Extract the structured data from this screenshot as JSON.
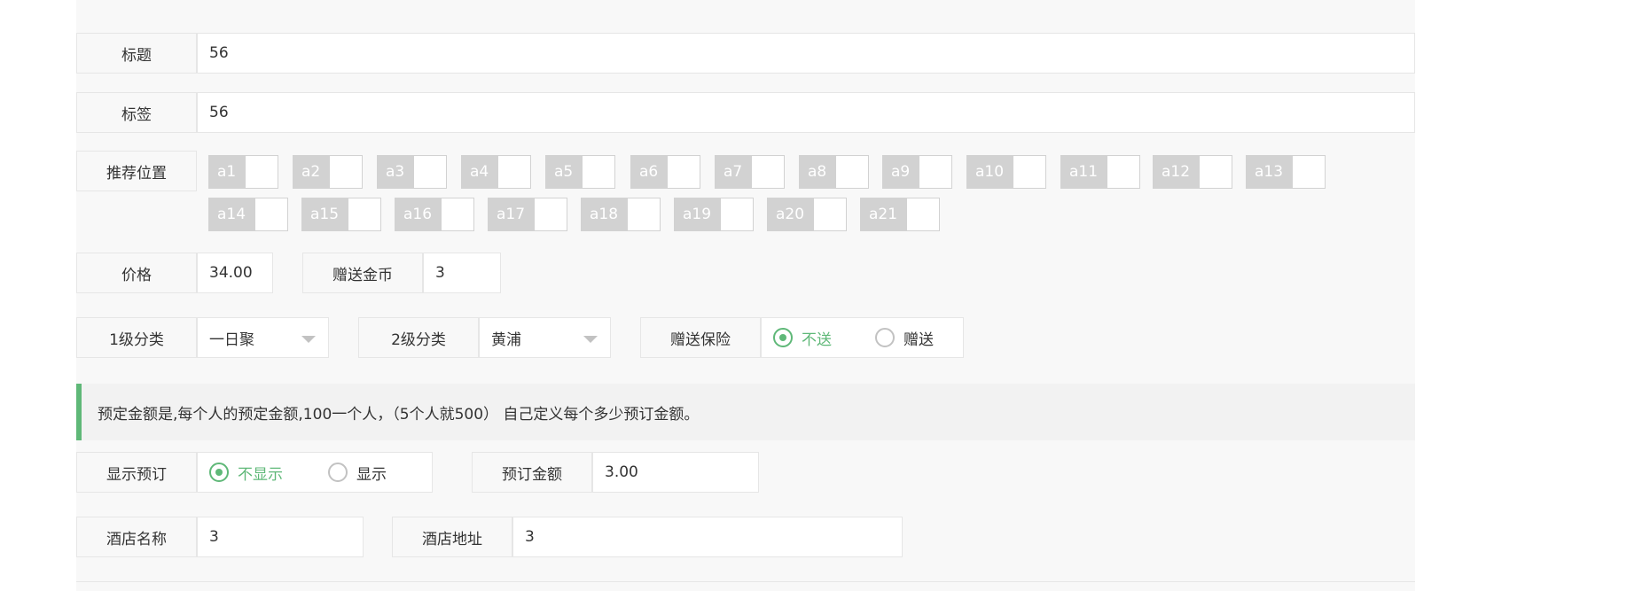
{
  "title_field": {
    "label": "标题",
    "value": "56"
  },
  "tags_field": {
    "label": "标签",
    "value": "56"
  },
  "recommend": {
    "label": "推荐位置",
    "options": [
      "a1",
      "a2",
      "a3",
      "a4",
      "a5",
      "a6",
      "a7",
      "a8",
      "a9",
      "a10",
      "a11",
      "a12",
      "a13",
      "a14",
      "a15",
      "a16",
      "a17",
      "a18",
      "a19",
      "a20",
      "a21"
    ]
  },
  "price": {
    "label": "价格",
    "value": "34.00"
  },
  "gift_coins": {
    "label": "赠送金币",
    "value": "3"
  },
  "category1": {
    "label": "1级分类",
    "value": "一日聚"
  },
  "category2": {
    "label": "2级分类",
    "value": "黄浦"
  },
  "insurance": {
    "label": "赠送保险",
    "options": [
      "不送",
      "赠送"
    ],
    "selected": "不送"
  },
  "notice": "预定金额是,每个人的预定金额,100一个人，（5个人就500） 自己定义每个多少预订金额。",
  "show_booking": {
    "label": "显示预订",
    "options": [
      "不显示",
      "显示"
    ],
    "selected": "不显示"
  },
  "booking_amount": {
    "label": "预订金额",
    "value": "3.00"
  },
  "hotel_name": {
    "label": "酒店名称",
    "value": "3"
  },
  "hotel_address": {
    "label": "酒店地址",
    "value": "3"
  },
  "colors": {
    "accent": "#5fb878",
    "checkbox_gray": "#d2d2d2"
  }
}
